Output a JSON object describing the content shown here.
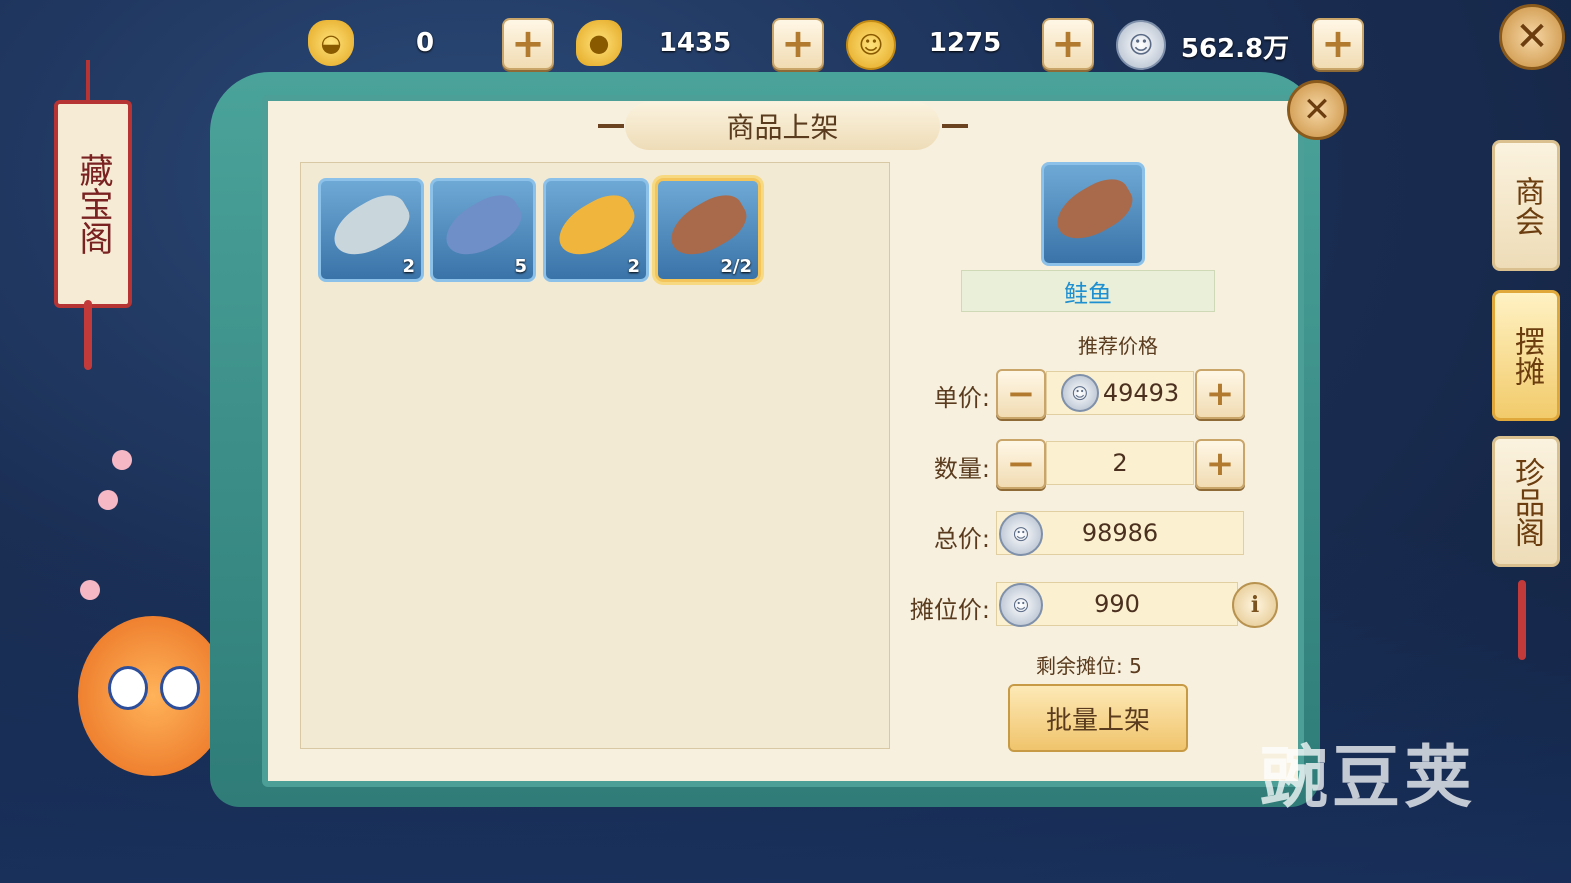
{
  "currencies": [
    {
      "icon": "gold-ingot-icon",
      "value": "0"
    },
    {
      "icon": "gold-nugget-icon",
      "value": "1435"
    },
    {
      "icon": "gold-coin-icon",
      "value": "1275"
    },
    {
      "icon": "silver-coin-icon",
      "value": "562.8万"
    }
  ],
  "left_banner": {
    "title": "藏宝阁"
  },
  "dialog": {
    "title": "商品上架"
  },
  "inventory": [
    {
      "name": "fish-white",
      "count": "2",
      "color": "#c9d6dc"
    },
    {
      "name": "fish-blue",
      "count": "5",
      "color": "#6f8fc8"
    },
    {
      "name": "fish-gold",
      "count": "2",
      "color": "#f0b53c"
    },
    {
      "name": "fish-salmon",
      "count": "2/2",
      "color": "#a86a4a",
      "selected": true
    }
  ],
  "detail": {
    "item_name": "鲑鱼",
    "recommended_label": "推荐价格",
    "unit_price_label": "单价:",
    "unit_price": "49493",
    "quantity_label": "数量:",
    "quantity": "2",
    "total_label": "总价:",
    "total": "98986",
    "stall_fee_label": "摊位价:",
    "stall_fee": "990",
    "remaining_label": "剩余摊位: 5",
    "batch_button": "批量上架"
  },
  "side_tabs": [
    {
      "label": "商会",
      "active": false
    },
    {
      "label": "摆摊",
      "active": true
    },
    {
      "label": "珍品阁",
      "active": false
    }
  ],
  "watermark": "豌豆荚",
  "colors": {
    "teal": "#4b9f97",
    "parchment": "#f7f0df",
    "accent_blue": "#1e8fd0",
    "button_gold": "#f0c46c"
  }
}
